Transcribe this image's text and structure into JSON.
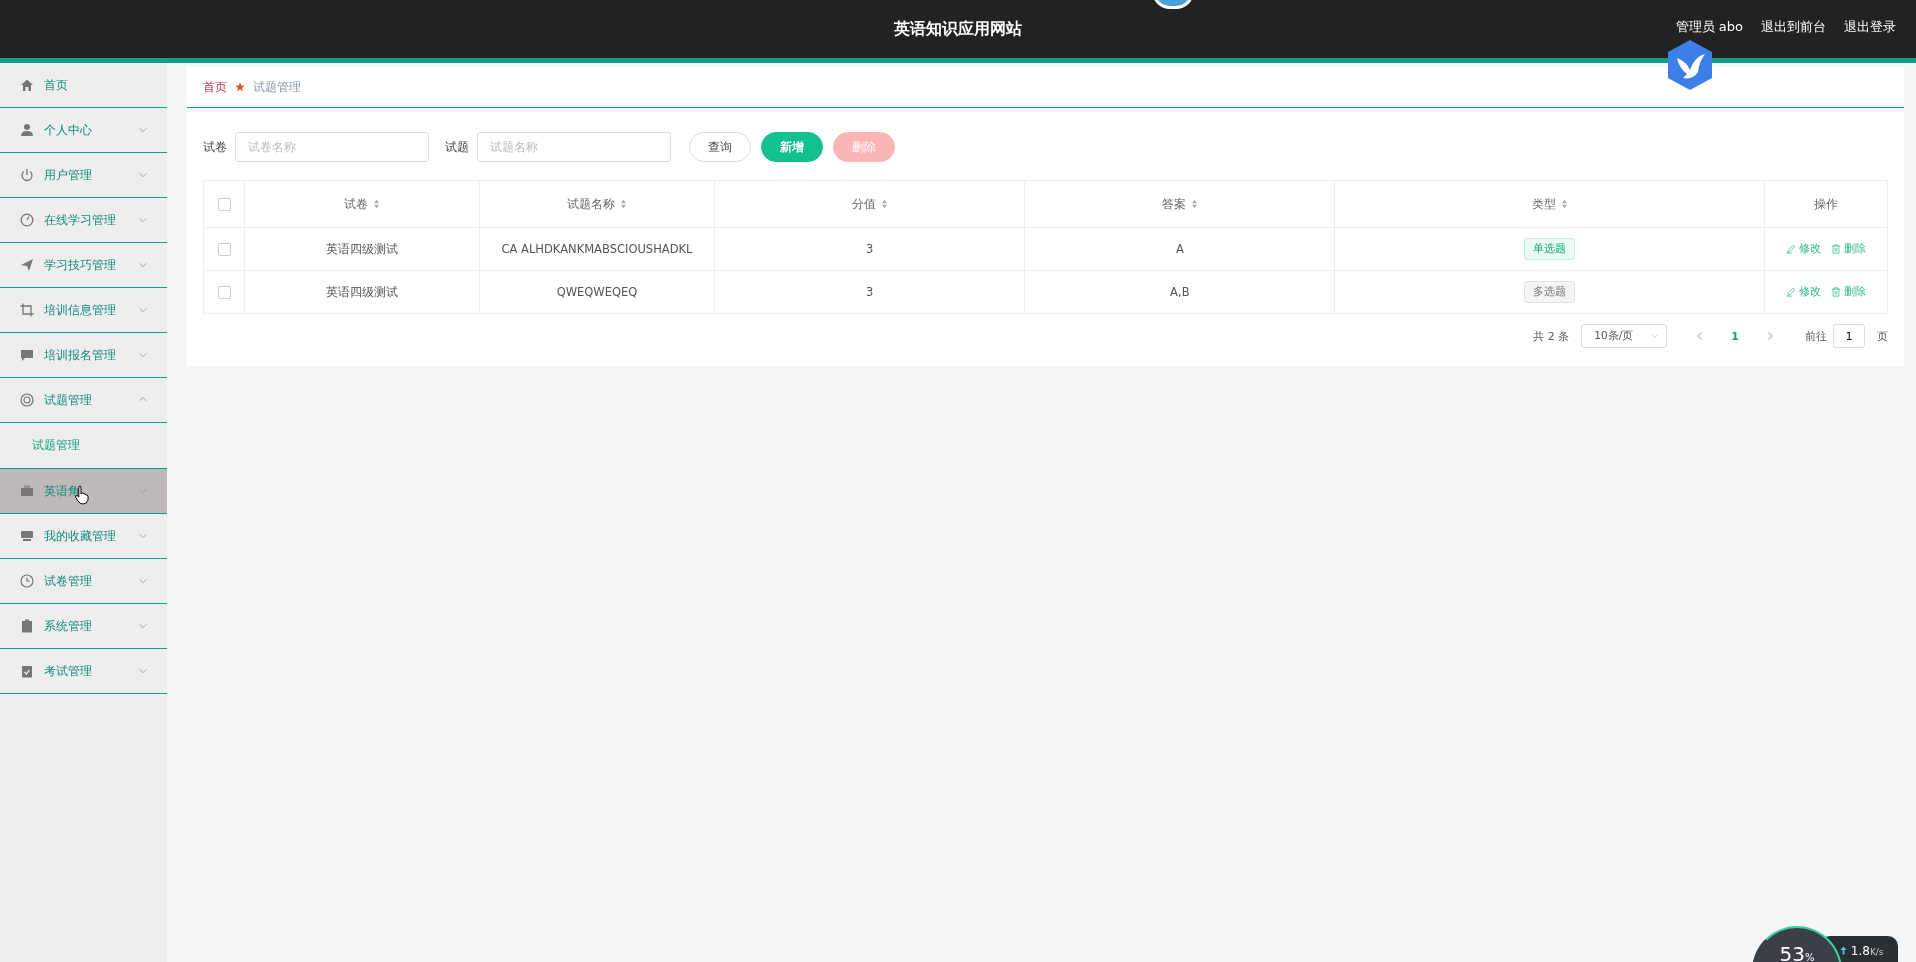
{
  "header": {
    "title": "英语知识应用网站",
    "user": "管理员 abo",
    "links": [
      "退出到前台",
      "退出登录"
    ]
  },
  "sidebar": {
    "items": [
      {
        "label": "首页",
        "kind": "link",
        "hovered": false
      },
      {
        "label": "个人中心",
        "kind": "group",
        "expanded": false,
        "hovered": false
      },
      {
        "label": "用户管理",
        "kind": "group",
        "expanded": false,
        "hovered": false
      },
      {
        "label": "在线学习管理",
        "kind": "group",
        "expanded": false,
        "hovered": false
      },
      {
        "label": "学习技巧管理",
        "kind": "group",
        "expanded": false,
        "hovered": false
      },
      {
        "label": "培训信息管理",
        "kind": "group",
        "expanded": false,
        "hovered": false
      },
      {
        "label": "培训报名管理",
        "kind": "group",
        "expanded": false,
        "hovered": false
      },
      {
        "label": "试题管理",
        "kind": "group",
        "expanded": true,
        "hovered": false,
        "children": [
          {
            "label": "试题管理",
            "selected": true
          }
        ]
      },
      {
        "label": "英语角",
        "kind": "group",
        "expanded": false,
        "hovered": true
      },
      {
        "label": "我的收藏管理",
        "kind": "group",
        "expanded": false,
        "hovered": false
      },
      {
        "label": "试卷管理",
        "kind": "group",
        "expanded": false,
        "hovered": false
      },
      {
        "label": "系统管理",
        "kind": "group",
        "expanded": false,
        "hovered": false
      },
      {
        "label": "考试管理",
        "kind": "group",
        "expanded": false,
        "hovered": false
      }
    ]
  },
  "breadcrumb": [
    "首页",
    "试题管理"
  ],
  "filters": [
    {
      "label": "试卷",
      "placeholder": "试卷名称"
    },
    {
      "label": "试题",
      "placeholder": "试题名称"
    }
  ],
  "buttons": [
    {
      "label": "查询",
      "kind": "plain",
      "disabled": false
    },
    {
      "label": "新增",
      "kind": "primary",
      "disabled": false
    },
    {
      "label": "删除",
      "kind": "danger",
      "disabled": true
    }
  ],
  "table": {
    "all_checked": false,
    "columns": [
      "试卷",
      "试题名称",
      "分值",
      "答案",
      "类型",
      "操作"
    ],
    "rows": [
      {
        "checked": false,
        "cells": [
          "英语四级测试",
          "CA ALHDKANKMABSCIOUSHADKL",
          "3",
          "A"
        ],
        "type": {
          "label": "单选题",
          "kind": "success"
        },
        "actions": [
          "修改",
          "删除"
        ]
      },
      {
        "checked": false,
        "cells": [
          "英语四级测试",
          "QWEQWEQEQ",
          "3",
          "A,B"
        ],
        "type": {
          "label": "多选题",
          "kind": "info"
        },
        "actions": [
          "修改",
          "删除"
        ]
      }
    ]
  },
  "pagination": {
    "total": "共 2 条",
    "page_size": "10条/页",
    "pages": [
      {
        "label": "1",
        "selected": true
      }
    ],
    "goto_label": "前往",
    "goto_value": "1",
    "page_suffix": "页"
  },
  "overlay": {
    "percent": "53",
    "percent_unit": "%",
    "speed": "1.8",
    "speed_unit": "K/s"
  }
}
